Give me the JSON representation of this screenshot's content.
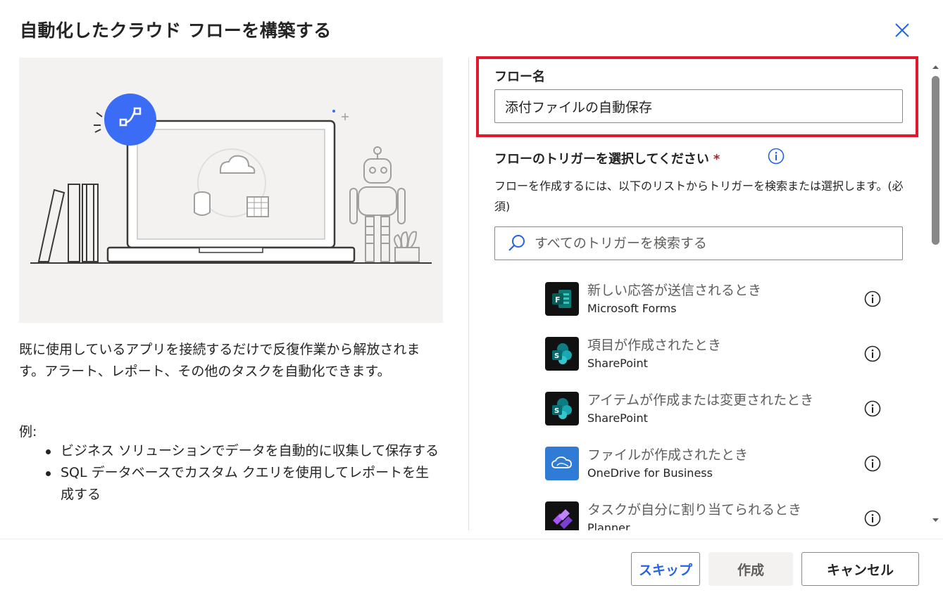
{
  "dialog": {
    "title": "自動化したクラウド フローを構築する"
  },
  "left": {
    "description": "既に使用しているアプリを接続するだけで反復作業から解放されます。アラート、レポート、その他のタスクを自動化できます。",
    "example_label": "例:",
    "examples": [
      "ビジネス ソリューションでデータを自動的に収集して保存する",
      "SQL データベースでカスタム クエリを使用してレポートを生成する"
    ]
  },
  "form": {
    "flow_name_label": "フロー名",
    "flow_name_value": "添付ファイルの自動保存",
    "trigger_label": "フローのトリガーを選択してください",
    "required_mark": "*",
    "help_text": "フローを作成するには、以下のリストからトリガーを検索または選択します。(必須)",
    "search_placeholder": "すべてのトリガーを検索する"
  },
  "triggers": [
    {
      "name": "新しい応答が送信されるとき",
      "connector": "Microsoft Forms",
      "icon": "microsoft-forms-icon"
    },
    {
      "name": "項目が作成されたとき",
      "connector": "SharePoint",
      "icon": "sharepoint-icon"
    },
    {
      "name": "アイテムが作成または変更されたとき",
      "connector": "SharePoint",
      "icon": "sharepoint-icon"
    },
    {
      "name": "ファイルが作成されたとき",
      "connector": "OneDrive for Business",
      "icon": "onedrive-icon"
    },
    {
      "name": "タスクが自分に割り当てられるとき",
      "connector": "Planner",
      "icon": "planner-icon"
    }
  ],
  "buttons": {
    "skip": "スキップ",
    "create": "作成",
    "cancel": "キャンセル"
  },
  "colors": {
    "accent": "#2563eb",
    "highlight": "#e3182d",
    "required": "#a4262c",
    "flow_badge": "#3b6cf6",
    "forms": "#0b7a75",
    "sharepoint": "#0f7b83",
    "onedrive": "#2f7bd6",
    "planner": "#7b3fd3"
  }
}
